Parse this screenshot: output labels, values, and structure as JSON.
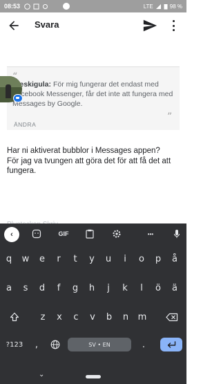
{
  "statusbar": {
    "time": "08:53",
    "network": "LTE",
    "battery": "98 %"
  },
  "appbar": {
    "title": "Svara",
    "back_icon": "arrow-left-icon",
    "send_icon": "send-icon",
    "more_icon": "more-vert-icon"
  },
  "quote": {
    "author": "Dieskigula:",
    "text": " För mig fungerar det endast med Facebook Messenger, får det inte att fungera med Messages by Google.",
    "edit_label": "ÄNDRA"
  },
  "compose": {
    "text": "Har ni aktiverat bubblor i Messages appen?\nFör jag va tvungen att göra det för att få det att fungera.",
    "hint": "Plustecken Skriv"
  },
  "keyboard": {
    "toolbar": {
      "gif_label": "GIF",
      "more_label": "•••"
    },
    "row1": [
      "q",
      "w",
      "e",
      "r",
      "t",
      "y",
      "u",
      "i",
      "o",
      "p",
      "å"
    ],
    "row2": [
      "a",
      "s",
      "d",
      "f",
      "g",
      "h",
      "j",
      "k",
      "l",
      "ö",
      "ä"
    ],
    "row3": [
      "z",
      "x",
      "c",
      "v",
      "b",
      "n",
      "m"
    ],
    "symbols_label": "?123",
    "comma": ",",
    "space_label": "SV • EN",
    "period": "."
  },
  "colors": {
    "accent": "#8ab4f8",
    "keyboard_bg": "#303134",
    "statusbar_bg": "#9e9e9e"
  }
}
